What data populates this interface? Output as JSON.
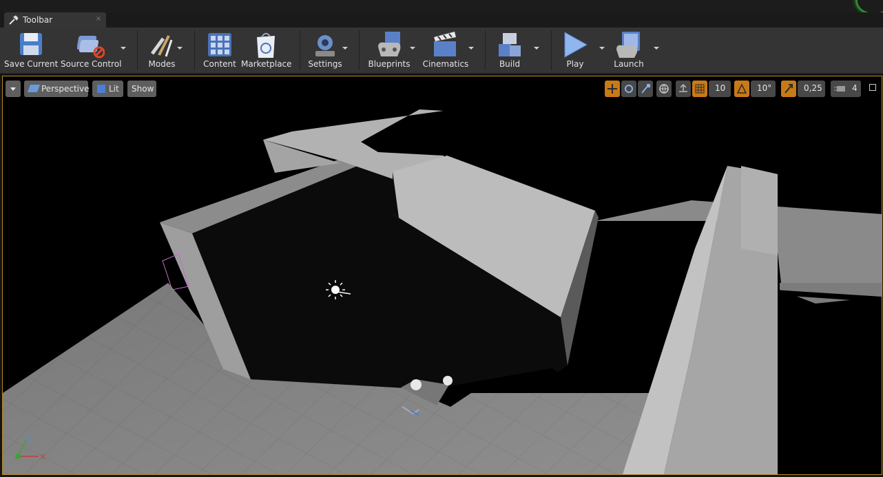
{
  "tab": {
    "title": "Toolbar",
    "close": "×"
  },
  "toolbar": {
    "save_current": "Save Current",
    "source_control": "Source Control",
    "modes": "Modes",
    "content": "Content",
    "marketplace": "Marketplace",
    "settings": "Settings",
    "blueprints": "Blueprints",
    "cinematics": "Cinematics",
    "build": "Build",
    "play": "Play",
    "launch": "Launch"
  },
  "viewport": {
    "perspective": "Perspective",
    "lit": "Lit",
    "show": "Show",
    "grid_snap": "10",
    "rotation_snap": "10°",
    "scale_snap": "0,25",
    "camera_speed": "4",
    "axis_z": "Z",
    "axis_x": "X"
  },
  "colors": {
    "accent_orange": "#c87a16",
    "viewport_border": "#b88a1e",
    "toolbar_bg": "#343434"
  }
}
